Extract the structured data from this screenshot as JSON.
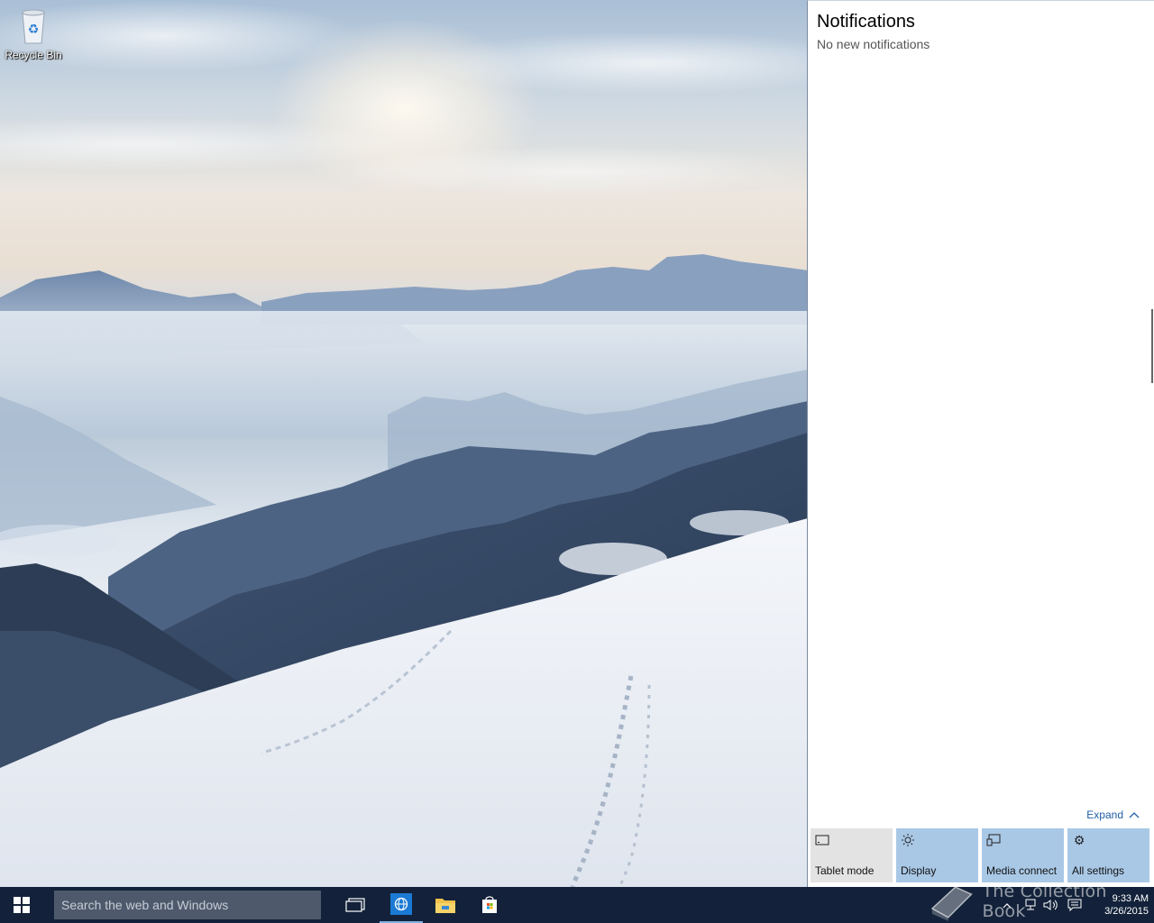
{
  "desktop": {
    "icons": [
      {
        "label": "Recycle Bin",
        "icon": "recycle-bin-icon"
      }
    ]
  },
  "action_center": {
    "title": "Notifications",
    "subtitle": "No new notifications",
    "expand_label": "Expand",
    "quick_actions": [
      {
        "label": "Tablet mode",
        "icon": "tablet-mode-icon",
        "active": false
      },
      {
        "label": "Display",
        "icon": "brightness-icon",
        "active": true
      },
      {
        "label": "Media connect",
        "icon": "media-connect-icon",
        "active": true
      },
      {
        "label": "All settings",
        "icon": "gear-icon",
        "active": true
      }
    ],
    "colors": {
      "tile_active": "#a9c8e6",
      "tile_inactive": "#e3e3e3",
      "link": "#1f5fa6"
    }
  },
  "taskbar": {
    "search": {
      "placeholder": "Search the web and Windows"
    },
    "pinned": [
      {
        "name": "task-view",
        "icon": "task-view-icon"
      },
      {
        "name": "internet-explorer",
        "icon": "internet-explorer-icon"
      },
      {
        "name": "file-explorer",
        "icon": "folder-icon"
      },
      {
        "name": "store",
        "icon": "store-icon"
      }
    ],
    "clock": {
      "time": "9:33 AM",
      "date": "3/26/2015"
    },
    "color": "#13223a"
  },
  "watermark": {
    "text": "The Collection Book"
  }
}
